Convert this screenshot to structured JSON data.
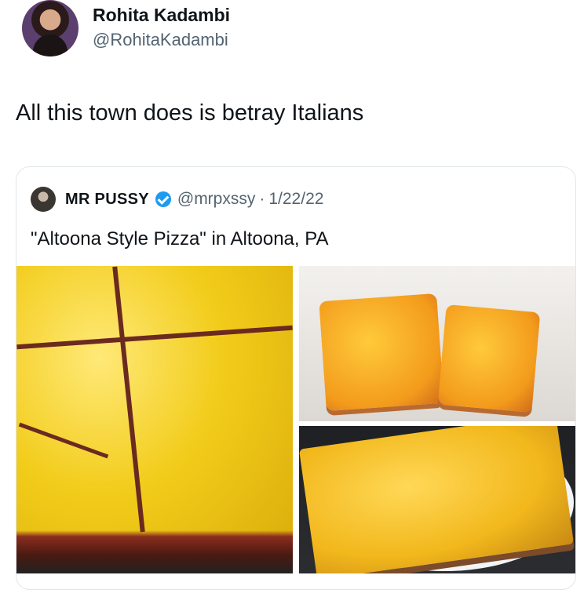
{
  "tweet": {
    "author_name": "Rohita Kadambi",
    "author_handle": "@RohitaKadambi",
    "text": "All this town does is betray Italians"
  },
  "quoted_tweet": {
    "author_name": "MR PUSSY",
    "author_handle": "@mrpxssy",
    "separator": "·",
    "date": "1/22/22",
    "text": "\"Altoona Style Pizza\" in Altoona, PA",
    "verified": true,
    "media": [
      {
        "name": "pizza-sheet-photo"
      },
      {
        "name": "pizza-boxed-slices-photo"
      },
      {
        "name": "pizza-plate-photo"
      }
    ]
  },
  "colors": {
    "text_primary": "#0f1419",
    "text_secondary": "#536471",
    "verified_blue": "#1d9bf0",
    "border": "#e1e6ea"
  }
}
